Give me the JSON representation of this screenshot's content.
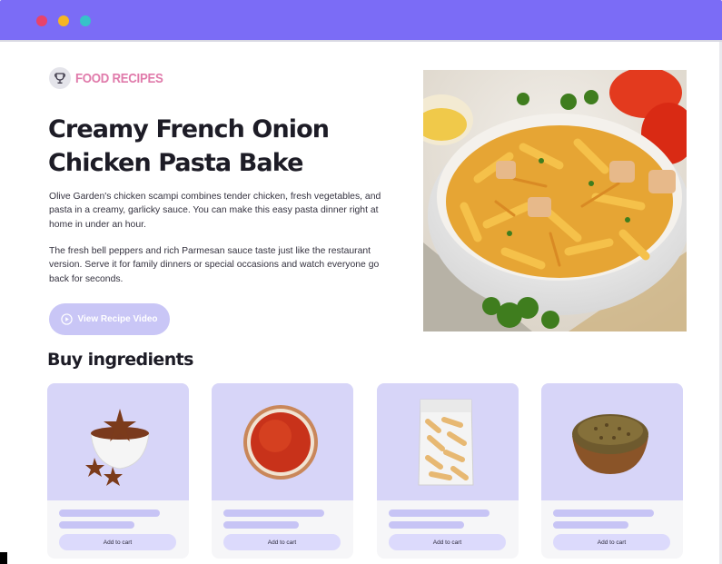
{
  "window": {
    "controls": [
      "close",
      "minimize",
      "zoom"
    ]
  },
  "brand": {
    "name": "FOOD RECIPES",
    "icon": "trophy-cup-icon",
    "color": "#e07bab"
  },
  "recipe": {
    "title": "Creamy French Onion Chicken Pasta Bake",
    "paragraphs": [
      "Olive Garden's chicken scampi combines tender chicken, fresh vegetables, and pasta in a creamy, garlicky sauce. You can make this easy pasta dinner right at home in under an hour.",
      "The fresh bell peppers and rich Parmesan sauce taste just like the restaurant version. Serve it for family dinners or special occasions and watch everyone go back for seconds."
    ],
    "video_button": "View Recipe Video",
    "hero_image": "pasta-bowl-photo"
  },
  "ingredients": {
    "heading": "Buy ingredients",
    "items": [
      {
        "image": "star-anise-bowl",
        "cart_label": "Add to cart"
      },
      {
        "image": "paprika-bowl",
        "cart_label": "Add to cart"
      },
      {
        "image": "penne-pasta-bag",
        "cart_label": "Add to cart"
      },
      {
        "image": "cumin-seeds-bowl",
        "cart_label": "Add to cart"
      }
    ]
  },
  "colors": {
    "titlebar": "#7b6cf6",
    "accent": "#c9c6f6",
    "card_image_bg": "#d7d5f8"
  }
}
